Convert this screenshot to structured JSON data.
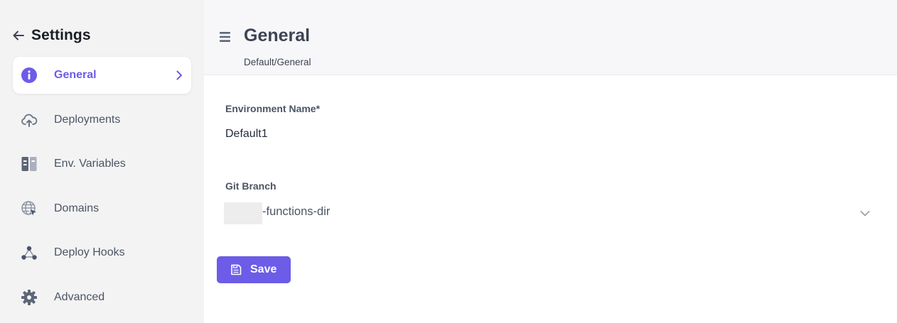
{
  "sidebar": {
    "title": "Settings",
    "items": [
      {
        "label": "General",
        "icon": "info-icon",
        "active": true
      },
      {
        "label": "Deployments",
        "icon": "cloud-upload-icon"
      },
      {
        "label": "Env. Variables",
        "icon": "env-variables-icon"
      },
      {
        "label": "Domains",
        "icon": "globe-icon"
      },
      {
        "label": "Deploy Hooks",
        "icon": "webhook-icon"
      },
      {
        "label": "Advanced",
        "icon": "gear-icon"
      }
    ]
  },
  "header": {
    "title": "General",
    "breadcrumb": "Default/General"
  },
  "form": {
    "env_name_label": "Environment Name*",
    "env_name_value": "Default1",
    "git_branch_label": "Git Branch",
    "git_branch_value": "-functions-dir",
    "save_label": "Save"
  },
  "colors": {
    "accent": "#6c5ce7",
    "sidebar_bg": "#f3f3f4",
    "topbar_bg": "#f7f7f9",
    "icon_gray": "#6b7386"
  }
}
